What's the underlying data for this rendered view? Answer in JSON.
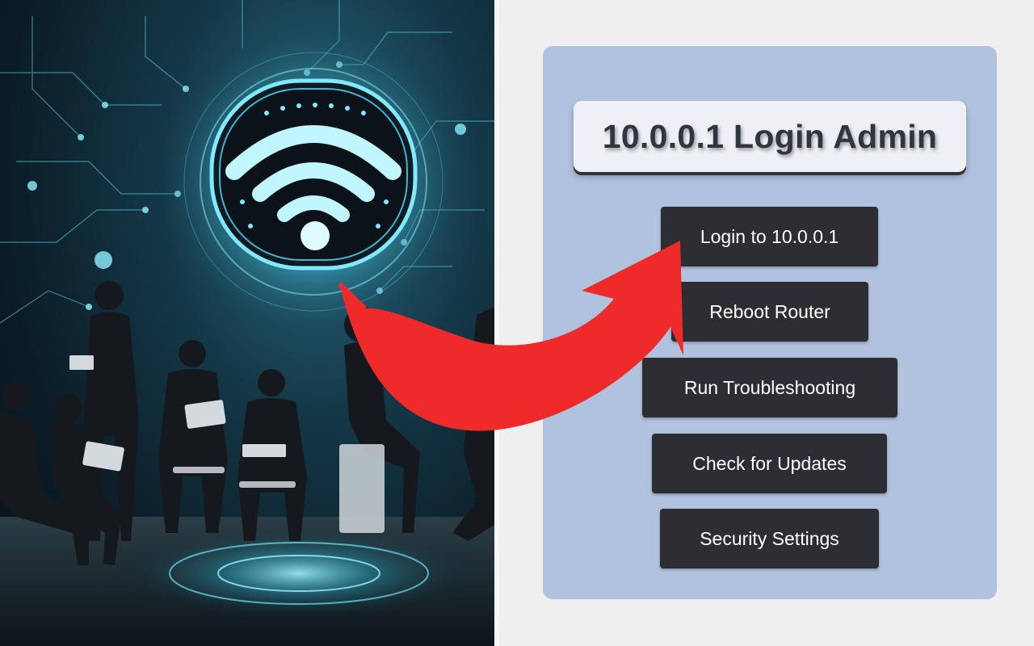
{
  "popup": {
    "title": "10.0.0.1 Login Admin",
    "buttons": {
      "login": "Login to 10.0.0.1",
      "reboot": "Reboot Router",
      "troubleshoot": "Run Troubleshooting",
      "updates": "Check for Updates",
      "security": "Security Settings"
    }
  },
  "colors": {
    "panel_bg": "#b0c2de",
    "button_bg": "#2c2e33",
    "title_card_bg": "#eef0f5",
    "arrow": "#ee2a2a",
    "wifi_glow": "#7fe9ff"
  },
  "icons": {
    "hero": "wifi-icon",
    "pointer": "curved-arrow"
  }
}
